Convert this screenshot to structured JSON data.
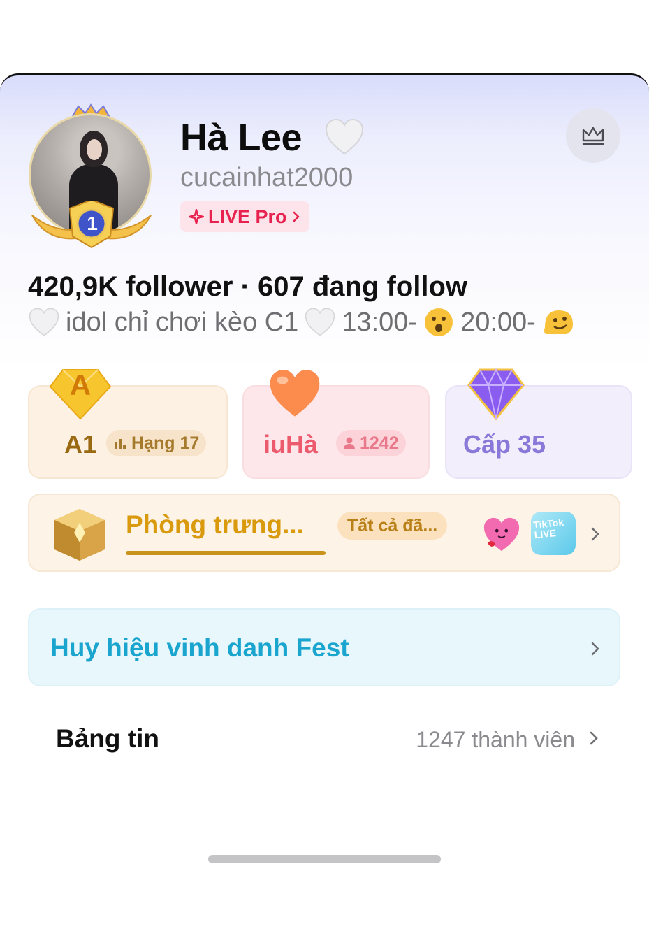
{
  "profile": {
    "display_name": "Hà Lee",
    "username": "cucainhat2000",
    "live_badge": "LIVE Pro",
    "avatar_rank": "1",
    "stats": "420,9K follower · 607 đang follow",
    "bio_1": "idol chỉ chơi kèo C1",
    "bio_2": "13:00-",
    "bio_3": "20:00-"
  },
  "cards": {
    "a1": {
      "icon_letter": "A",
      "label": "A1",
      "chip": "Hạng 17"
    },
    "fan": {
      "label": "iuHà",
      "chip": "1242"
    },
    "level": {
      "label": "Cấp 35"
    }
  },
  "trophy_room": {
    "title": "Phòng trưng...",
    "chip": "Tất cả đã..."
  },
  "fest": {
    "title": "Huy hiệu vinh danh Fest"
  },
  "feed": {
    "title": "Bảng tin",
    "count": "1247  thành viên"
  },
  "icons": {
    "crown_button": "crown-icon",
    "heart": "white-heart-icon",
    "sparkle": "sparkle-icon",
    "chevron": "chevron-right-icon"
  },
  "colors": {
    "live_red": "#e8224f",
    "gold": "#d99a0e",
    "fan_pink": "#ec5a6e",
    "level_purple": "#8a79d8",
    "fest_blue": "#1aa5cf"
  }
}
